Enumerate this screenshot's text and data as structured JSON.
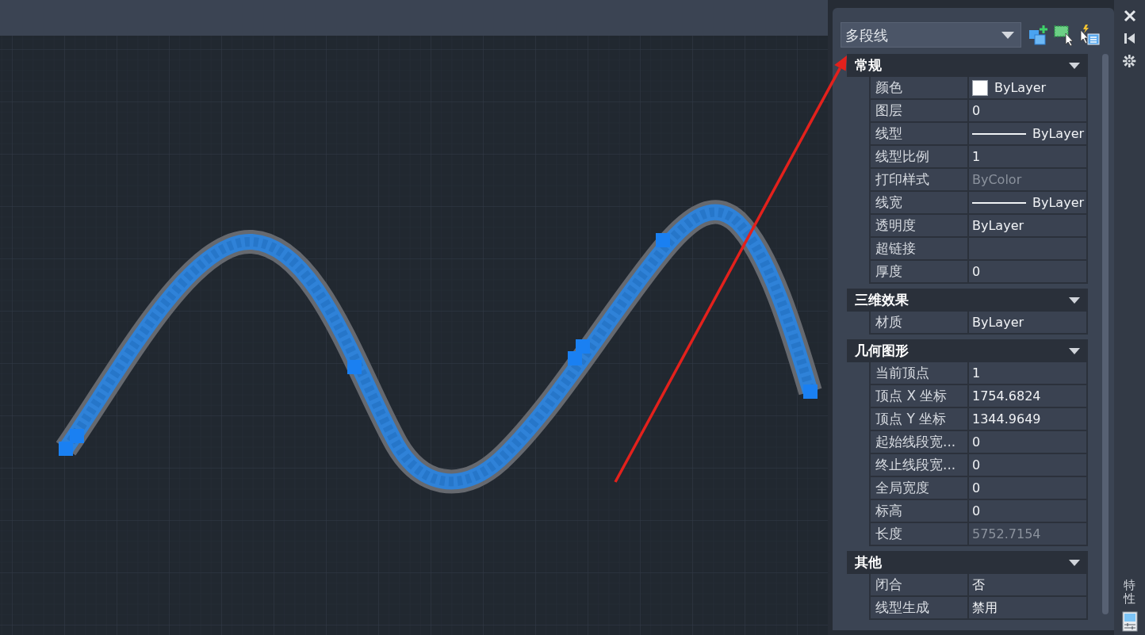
{
  "properties_panel": {
    "object_type": {
      "value": "多段线"
    },
    "sections": [
      {
        "title": "常规",
        "expanded": true,
        "rows": [
          {
            "label": "颜色",
            "value": "ByLayer",
            "kind": "color",
            "color": "#ffffff",
            "disabled": false
          },
          {
            "label": "图层",
            "value": "0",
            "kind": "text",
            "disabled": false
          },
          {
            "label": "线型",
            "value": "ByLayer",
            "kind": "line",
            "disabled": false
          },
          {
            "label": "线型比例",
            "value": "1",
            "kind": "text",
            "disabled": false
          },
          {
            "label": "打印样式",
            "value": "ByColor",
            "kind": "text",
            "disabled": true
          },
          {
            "label": "线宽",
            "value": "ByLayer",
            "kind": "line",
            "disabled": false
          },
          {
            "label": "透明度",
            "value": "ByLayer",
            "kind": "text",
            "disabled": false
          },
          {
            "label": "超链接",
            "kind": "text",
            "disabled": false
          },
          {
            "label": "厚度",
            "value": "0",
            "kind": "text",
            "disabled": false
          }
        ]
      },
      {
        "title": "三维效果",
        "expanded": true,
        "rows": [
          {
            "label": "材质",
            "value": "ByLayer",
            "kind": "text",
            "disabled": false
          }
        ]
      },
      {
        "title": "几何图形",
        "expanded": true,
        "rows": [
          {
            "label": "当前顶点",
            "value": "1",
            "kind": "text",
            "disabled": false
          },
          {
            "label": "顶点 X 坐标",
            "value": "1754.6824",
            "kind": "text",
            "disabled": false
          },
          {
            "label": "顶点 Y 坐标",
            "value": "1344.9649",
            "kind": "text",
            "disabled": false
          },
          {
            "label": "起始线段宽...",
            "value": "0",
            "kind": "text",
            "disabled": false
          },
          {
            "label": "终止线段宽...",
            "value": "0",
            "kind": "text",
            "disabled": false
          },
          {
            "label": "全局宽度",
            "value": "0",
            "kind": "text",
            "disabled": false
          },
          {
            "label": "标高",
            "value": "0",
            "kind": "text",
            "disabled": false
          },
          {
            "label": "长度",
            "value": "5752.7154",
            "kind": "text",
            "disabled": true
          }
        ]
      },
      {
        "title": "其他",
        "expanded": true,
        "rows": [
          {
            "label": "闭合",
            "value": "否",
            "kind": "text",
            "disabled": false
          },
          {
            "label": "线型生成",
            "value": "禁用",
            "kind": "text",
            "disabled": false
          }
        ]
      }
    ]
  },
  "side_bar": {
    "title": "特性"
  }
}
